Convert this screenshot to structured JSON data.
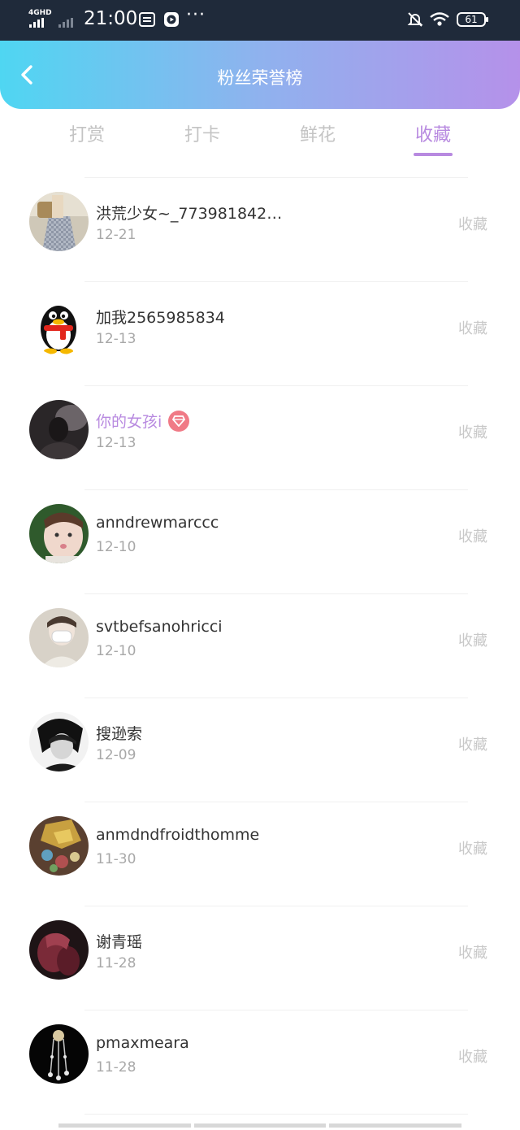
{
  "status_bar": {
    "network": "4GHD",
    "time": "21:00",
    "more": "···",
    "battery": "61"
  },
  "header": {
    "title": "粉丝荣誉榜",
    "gradient_start": "#4fd6f2",
    "gradient_end": "#b591ea"
  },
  "tabs": [
    {
      "label": "打赏",
      "active": false
    },
    {
      "label": "打卡",
      "active": false
    },
    {
      "label": "鲜花",
      "active": false
    },
    {
      "label": "收藏",
      "active": true
    }
  ],
  "accent_color": "#b88ae0",
  "fans": [
    {
      "name": "洪荒少女~_773981842…",
      "date": "12-21",
      "action": "收藏",
      "vip": false,
      "avatar": "avatar-photo-girl"
    },
    {
      "name": "加我2565985834",
      "date": "12-13",
      "action": "收藏",
      "vip": false,
      "avatar": "avatar-qq-penguin"
    },
    {
      "name": "你的女孩i",
      "date": "12-13",
      "action": "收藏",
      "vip": true,
      "avatar": "avatar-photo-dark"
    },
    {
      "name": "anndrewmarccc",
      "date": "12-10",
      "action": "收藏",
      "vip": false,
      "avatar": "avatar-photo-child"
    },
    {
      "name": "svtbefsanohricci",
      "date": "12-10",
      "action": "收藏",
      "vip": false,
      "avatar": "avatar-photo-mask"
    },
    {
      "name": "搜逊索",
      "date": "12-09",
      "action": "收藏",
      "vip": false,
      "avatar": "avatar-photo-bw"
    },
    {
      "name": "anmdndfroidthomme",
      "date": "11-30",
      "action": "收藏",
      "vip": false,
      "avatar": "avatar-photo-gold"
    },
    {
      "name": "谢青瑶",
      "date": "11-28",
      "action": "收藏",
      "vip": false,
      "avatar": "avatar-photo-red"
    },
    {
      "name": "pmaxmeara",
      "date": "11-28",
      "action": "收藏",
      "vip": false,
      "avatar": "avatar-photo-jewelry"
    }
  ]
}
